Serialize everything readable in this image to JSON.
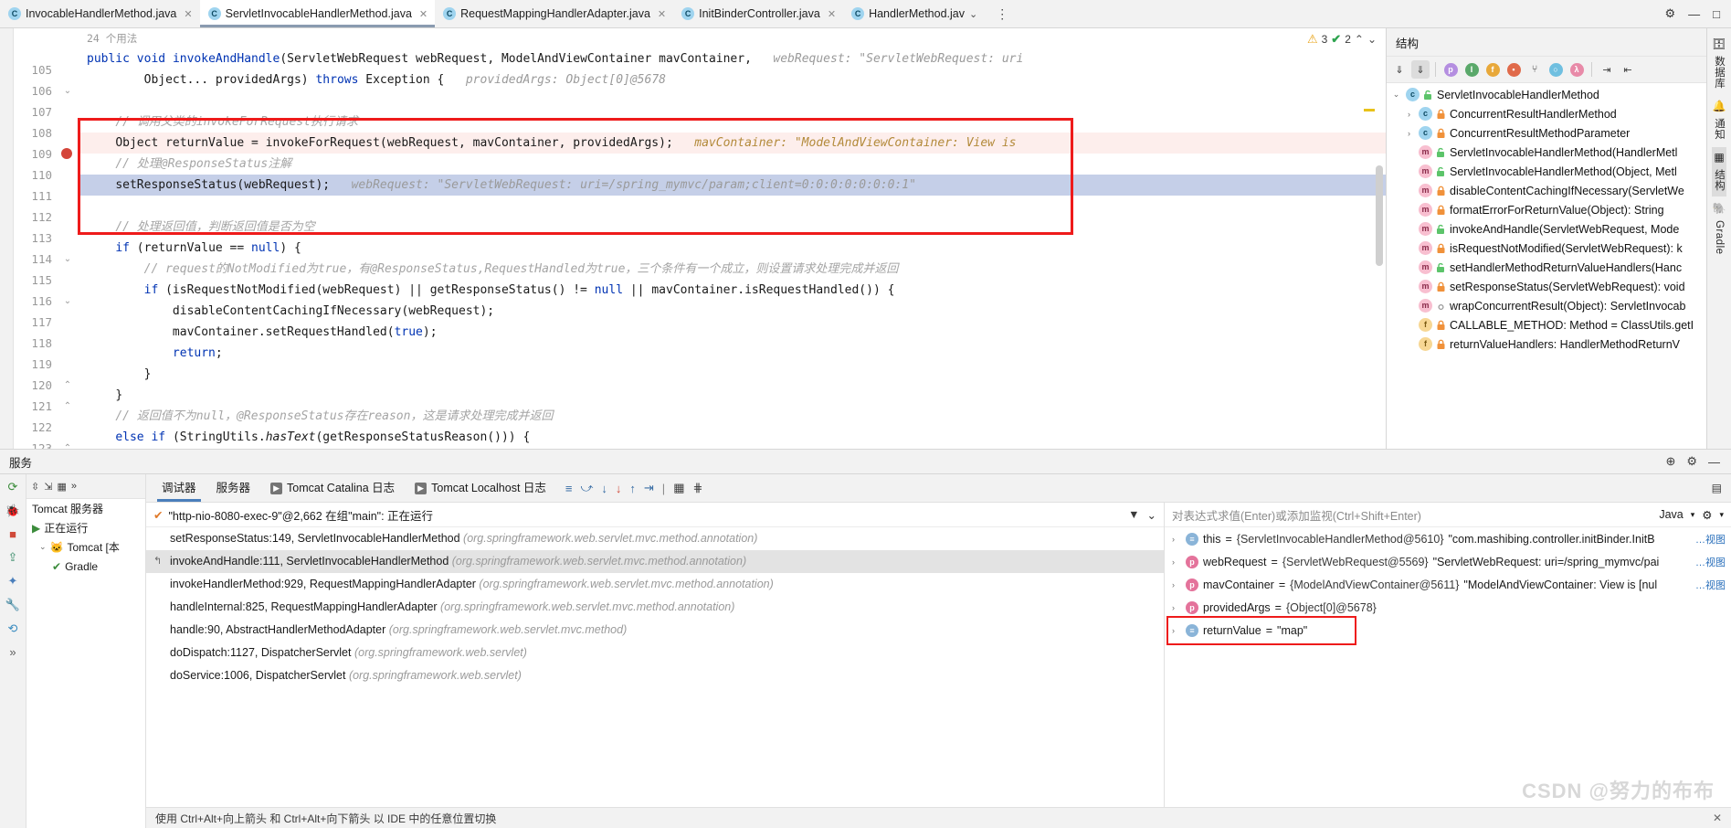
{
  "tabs": [
    {
      "label": "InvocableHandlerMethod.java",
      "active": false
    },
    {
      "label": "ServletInvocableHandlerMethod.java",
      "active": true
    },
    {
      "label": "RequestMappingHandlerAdapter.java",
      "active": false
    },
    {
      "label": "InitBinderController.java",
      "active": false
    },
    {
      "label": "HandlerMethod.jav",
      "active": false
    }
  ],
  "editor": {
    "usages_label": "24 个用法",
    "warning_count": "3",
    "ok_count": "2",
    "lines": [
      {
        "num": "105",
        "type": "code",
        "html": "sig1"
      },
      {
        "num": "106",
        "type": "code",
        "html": "sig2"
      },
      {
        "num": "107",
        "type": "blank"
      },
      {
        "num": "108",
        "type": "comment",
        "text": "// 调用父类的invokeForRequest执行请求"
      },
      {
        "num": "109",
        "type": "exec",
        "text": "Object returnValue = invokeForRequest(webRequest, mavContainer, providedArgs);",
        "hint": "mavContainer: \"ModelAndViewContainer: View is"
      },
      {
        "num": "110",
        "type": "comment",
        "text": "// 处理@ResponseStatus注解"
      },
      {
        "num": "111",
        "type": "cur",
        "text": "setResponseStatus(webRequest);",
        "hint": "webRequest: \"ServletWebRequest: uri=/spring_mymvc/param;client=0:0:0:0:0:0:0:1\""
      },
      {
        "num": "112",
        "type": "blank"
      },
      {
        "num": "113",
        "type": "comment",
        "text": "// 处理返回值，判断返回值是否为空"
      },
      {
        "num": "114",
        "type": "code",
        "text": "if (returnValue == null) {"
      },
      {
        "num": "115",
        "type": "comment",
        "text": "// request的NotModified为true，有@ResponseStatus,RequestHandled为true，三个条件有一个成立，则设置请求处理完成并返回"
      },
      {
        "num": "116",
        "type": "code",
        "text": "if (isRequestNotModified(webRequest) || getResponseStatus() != null || mavContainer.isRequestHandled()) {"
      },
      {
        "num": "117",
        "type": "code",
        "text": "disableContentCachingIfNecessary(webRequest);"
      },
      {
        "num": "118",
        "type": "code",
        "text": "mavContainer.setRequestHandled(true);"
      },
      {
        "num": "119",
        "type": "code",
        "text": "return;"
      },
      {
        "num": "120",
        "type": "code",
        "text": "}"
      },
      {
        "num": "121",
        "type": "code",
        "text": "}"
      },
      {
        "num": "122",
        "type": "comment",
        "text": "// 返回值不为null，@ResponseStatus存在reason，这是请求处理完成并返回"
      },
      {
        "num": "123",
        "type": "code",
        "text": "else if (StringUtils.hasText(getResponseStatusReason())) {"
      }
    ],
    "sig_line1_parts": {
      "kw1": "public",
      "kw2": "void",
      "name": "invokeAndHandle",
      "args": "(ServletWebRequest webRequest, ModelAndViewContainer mavContainer,",
      "hint": "webRequest: \"ServletWebRequest: uri"
    },
    "sig_line2_parts": {
      "args": "Object... providedArgs) ",
      "kw": "throws",
      "rest": " Exception {",
      "hint": "providedArgs: Object[0]@5678"
    }
  },
  "structure": {
    "title": "结构",
    "toolbar_icons": [
      "sort-by-visibility-icon",
      "sort-alphabetically-icon",
      "show-properties-icon",
      "show-inherited-icon",
      "show-fields-icon",
      "show-non-public-icon",
      "show-anonymous-icon",
      "group-icon",
      "expand-all-icon",
      "collapse-all-icon",
      "scroll-from-source-icon",
      "scroll-to-source-icon"
    ],
    "nodes": [
      {
        "indent": 0,
        "arrow": "v",
        "icon": "c",
        "lock": "green",
        "label": "ServletInvocableHandlerMethod"
      },
      {
        "indent": 1,
        "arrow": ">",
        "icon": "c",
        "lock": "orange",
        "label": "ConcurrentResultHandlerMethod"
      },
      {
        "indent": 1,
        "arrow": ">",
        "icon": "c",
        "lock": "orange",
        "label": "ConcurrentResultMethodParameter"
      },
      {
        "indent": 1,
        "arrow": "",
        "icon": "m",
        "lock": "green",
        "label": "ServletInvocableHandlerMethod(HandlerMetl"
      },
      {
        "indent": 1,
        "arrow": "",
        "icon": "m",
        "lock": "green",
        "label": "ServletInvocableHandlerMethod(Object, Metl"
      },
      {
        "indent": 1,
        "arrow": "",
        "icon": "m",
        "lock": "orange",
        "label": "disableContentCachingIfNecessary(ServletWe"
      },
      {
        "indent": 1,
        "arrow": "",
        "icon": "m",
        "lock": "orange",
        "label": "formatErrorForReturnValue(Object): String"
      },
      {
        "indent": 1,
        "arrow": "",
        "icon": "m",
        "lock": "green",
        "label": "invokeAndHandle(ServletWebRequest, Mode"
      },
      {
        "indent": 1,
        "arrow": "",
        "icon": "m",
        "lock": "orange",
        "label": "isRequestNotModified(ServletWebRequest): k"
      },
      {
        "indent": 1,
        "arrow": "",
        "icon": "m",
        "lock": "green",
        "label": "setHandlerMethodReturnValueHandlers(Hanc"
      },
      {
        "indent": 1,
        "arrow": "",
        "icon": "m",
        "lock": "orange",
        "label": "setResponseStatus(ServletWebRequest): void"
      },
      {
        "indent": 1,
        "arrow": "",
        "icon": "m",
        "lock": "none",
        "label": "wrapConcurrentResult(Object): ServletInvocab"
      },
      {
        "indent": 1,
        "arrow": "",
        "icon": "f",
        "lock": "orange",
        "label": "CALLABLE_METHOD: Method = ClassUtils.getI"
      },
      {
        "indent": 1,
        "arrow": "",
        "icon": "f",
        "lock": "orange",
        "label": "returnValueHandlers: HandlerMethodReturnV"
      }
    ]
  },
  "right_rail": [
    {
      "label": "数据库",
      "selected": false
    },
    {
      "label": "通知",
      "selected": false
    },
    {
      "label": "结构",
      "selected": true
    },
    {
      "label": "Gradle",
      "selected": false
    }
  ],
  "services": {
    "header_title": "服务",
    "tree_title": "Tomcat 服务器",
    "tree_items": [
      {
        "label": "正在运行",
        "icon": "run-icon"
      },
      {
        "label": "Tomcat [本",
        "icon": "tomcat-icon"
      },
      {
        "label": "Gradle",
        "icon": "gradle-icon"
      }
    ]
  },
  "debugger": {
    "tabs": [
      {
        "label": "调试器",
        "active": true,
        "icon": ""
      },
      {
        "label": "服务器",
        "active": false,
        "icon": ""
      },
      {
        "label": "Tomcat Catalina 日志",
        "active": false,
        "icon": "▶"
      },
      {
        "label": "Tomcat Localhost 日志",
        "active": false,
        "icon": "▶"
      }
    ],
    "thread": "\"http-nio-8080-exec-9\"@2,662 在组\"main\": 正在运行",
    "frames": [
      {
        "method": "setResponseStatus:149, ServletInvocableHandlerMethod",
        "pkg": "(org.springframework.web.servlet.mvc.method.annotation)",
        "selected": false,
        "marker": ""
      },
      {
        "method": "invokeAndHandle:111, ServletInvocableHandlerMethod",
        "pkg": "(org.springframework.web.servlet.mvc.method.annotation)",
        "selected": true,
        "marker": "↰"
      },
      {
        "method": "invokeHandlerMethod:929, RequestMappingHandlerAdapter",
        "pkg": "(org.springframework.web.servlet.mvc.method.annotation)",
        "selected": false,
        "marker": ""
      },
      {
        "method": "handleInternal:825, RequestMappingHandlerAdapter",
        "pkg": "(org.springframework.web.servlet.mvc.method.annotation)",
        "selected": false,
        "marker": ""
      },
      {
        "method": "handle:90, AbstractHandlerMethodAdapter",
        "pkg": "(org.springframework.web.servlet.mvc.method)",
        "selected": false,
        "marker": ""
      },
      {
        "method": "doDispatch:1127, DispatcherServlet",
        "pkg": "(org.springframework.web.servlet)",
        "selected": false,
        "marker": ""
      },
      {
        "method": "doService:1006, DispatcherServlet",
        "pkg": "(org.springframework.web.servlet)",
        "selected": false,
        "marker": ""
      }
    ],
    "watch_placeholder": "对表达式求值(Enter)或添加监视(Ctrl+Shift+Enter)",
    "lang_label": "Java",
    "variables": [
      {
        "arrow": "›",
        "icon": "t",
        "name": "this",
        "eq": "=",
        "value": "{ServletInvocableHandlerMethod@5610}",
        "str": "\"com.mashibing.controller.initBinder.InitB",
        "link": "…视图",
        "highlight": false
      },
      {
        "arrow": "›",
        "icon": "p",
        "name": "webRequest",
        "eq": "=",
        "value": "{ServletWebRequest@5569}",
        "str": "\"ServletWebRequest: uri=/spring_mymvc/pai",
        "link": "…视图",
        "highlight": false
      },
      {
        "arrow": "›",
        "icon": "p",
        "name": "mavContainer",
        "eq": "=",
        "value": "{ModelAndViewContainer@5611}",
        "str": "\"ModelAndViewContainer: View is [nul",
        "link": "…视图",
        "highlight": false
      },
      {
        "arrow": "›",
        "icon": "p",
        "name": "providedArgs",
        "eq": "=",
        "value": "{Object[0]@5678}",
        "str": "",
        "link": "",
        "highlight": false
      },
      {
        "arrow": "›",
        "icon": "t",
        "name": "returnValue",
        "eq": "=",
        "value": "",
        "str": "\"map\"",
        "link": "",
        "highlight": true
      }
    ],
    "footer_hint": "使用 Ctrl+Alt+向上箭头 和 Ctrl+Alt+向下箭头 以 IDE 中的任意位置切换"
  },
  "watermark": "CSDN @努力的布布",
  "colors": {
    "red_highlight": "#ee1b1b",
    "exec_line_bg": "#fdeeec",
    "current_line_bg": "#c5cfe8",
    "accent_blue": "#0033b3"
  }
}
